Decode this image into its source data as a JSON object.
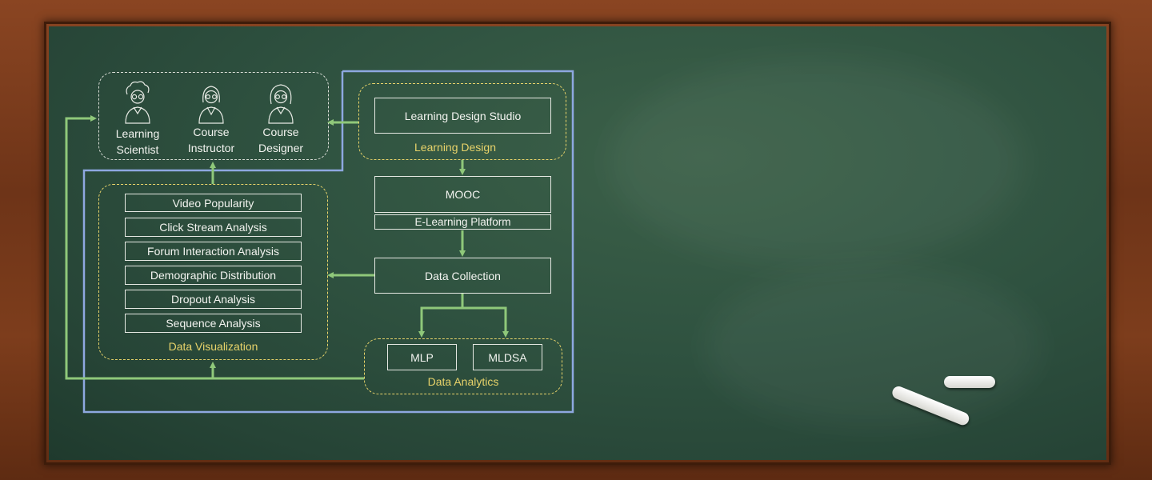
{
  "roles": [
    {
      "line1": "Learning",
      "line2": "Scientist"
    },
    {
      "line1": "Course",
      "line2": "Instructor"
    },
    {
      "line1": "Course",
      "line2": "Designer"
    }
  ],
  "learning_design": {
    "studio": "Learning Design Studio",
    "group_label": "Learning Design"
  },
  "platform": {
    "mooc": "MOOC",
    "subtitle": "E-Learning Platform"
  },
  "data_collection": "Data Collection",
  "visualization": {
    "items": [
      "Video Popularity",
      "Click Stream Analysis",
      "Forum Interaction Analysis",
      "Demographic Distribution",
      "Dropout Analysis",
      "Sequence Analysis"
    ],
    "group_label": "Data Visualization"
  },
  "analytics": {
    "items": [
      "MLP",
      "MLDSA"
    ],
    "group_label": "Data Analytics"
  },
  "colors": {
    "board": "#2f5240",
    "frame": "#7d3d1c",
    "arrow": "#8fc87a",
    "dash_yellow": "#e8d36a",
    "dash_white": "#d9ddd6",
    "blue_outline": "#8ea8e0",
    "text": "#f3f4f0"
  }
}
